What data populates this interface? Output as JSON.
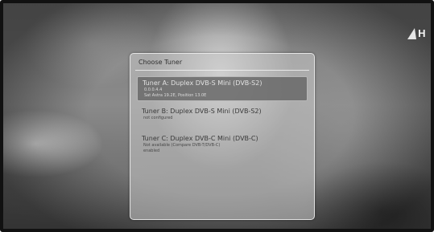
{
  "header": {
    "channel_logo_text": "H"
  },
  "dialog": {
    "title": "Choose Tuner",
    "tuners": [
      {
        "name": "Tuner A: Duplex DVB-S Mini (DVB-S2)",
        "details": [
          "0.0.0.4.4",
          "Sat Astra 19.2E, Position 13.0E"
        ],
        "selected": true
      },
      {
        "name": "Tuner B: Duplex DVB-S Mini (DVB-S2)",
        "details": [
          "not configured"
        ],
        "selected": false
      },
      {
        "name": "Tuner C: Duplex DVB-C Mini (DVB-C)",
        "details": [
          "Not available (Compare DVB-T/DVB-C)",
          "enabled"
        ],
        "selected": false
      }
    ]
  }
}
